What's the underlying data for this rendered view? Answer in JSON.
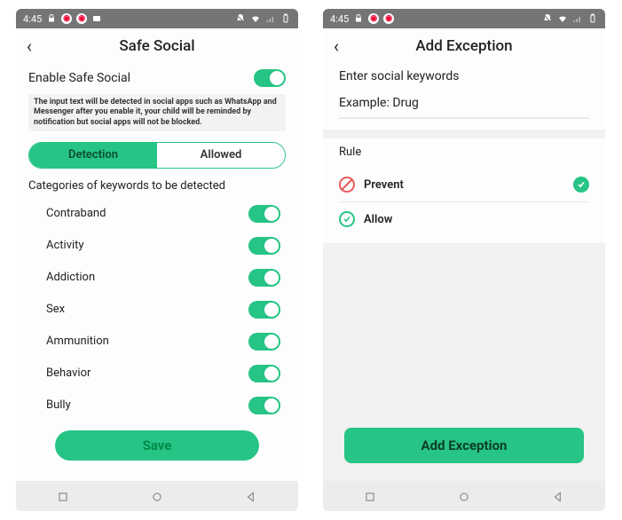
{
  "status": {
    "time": "4:45"
  },
  "screenA": {
    "title": "Safe Social",
    "enable_label": "Enable Safe Social",
    "info": "The input text will be detected in social apps such as WhatsApp and Messenger after you enable it, your child will be reminded by notification but social apps will not be blocked.",
    "tabs": {
      "detection": "Detection",
      "allowed": "Allowed"
    },
    "subhead": "Categories of keywords to be detected",
    "cats": [
      "Contraband",
      "Activity",
      "Addiction",
      "Sex",
      "Ammunition",
      "Behavior",
      "Bully"
    ],
    "save": "Save"
  },
  "screenB": {
    "title": "Add Exception",
    "prompt": "Enter social keywords",
    "example": "Example: Drug",
    "rule_label": "Rule",
    "prevent": "Prevent",
    "allow": "Allow",
    "cta": "Add Exception"
  }
}
